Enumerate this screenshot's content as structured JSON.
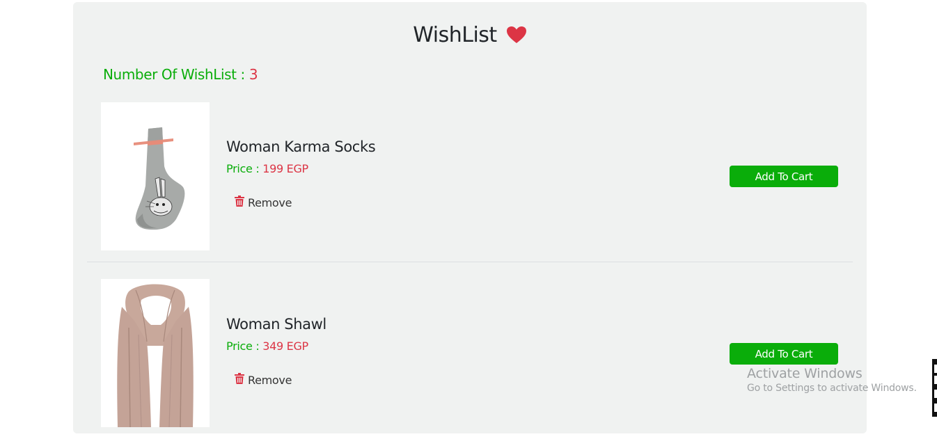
{
  "page": {
    "title": "WishList",
    "heart_color": "#dc3545",
    "count_label": "Number Of WishList :",
    "count_value": "3",
    "accent_green": "#0aad0a",
    "accent_red": "#dc3545"
  },
  "items": [
    {
      "name": "Woman Karma Socks",
      "price_label": "Price :",
      "price_value": "199 EGP",
      "remove_label": "Remove",
      "add_to_cart_label": "Add To Cart",
      "image_icon": "socks-image"
    },
    {
      "name": "Woman Shawl",
      "price_label": "Price :",
      "price_value": "349 EGP",
      "remove_label": "Remove",
      "add_to_cart_label": "Add To Cart",
      "image_icon": "shawl-image"
    }
  ],
  "os_watermark": {
    "line1": "Activate Windows",
    "line2": "Go to Settings to activate Windows."
  }
}
